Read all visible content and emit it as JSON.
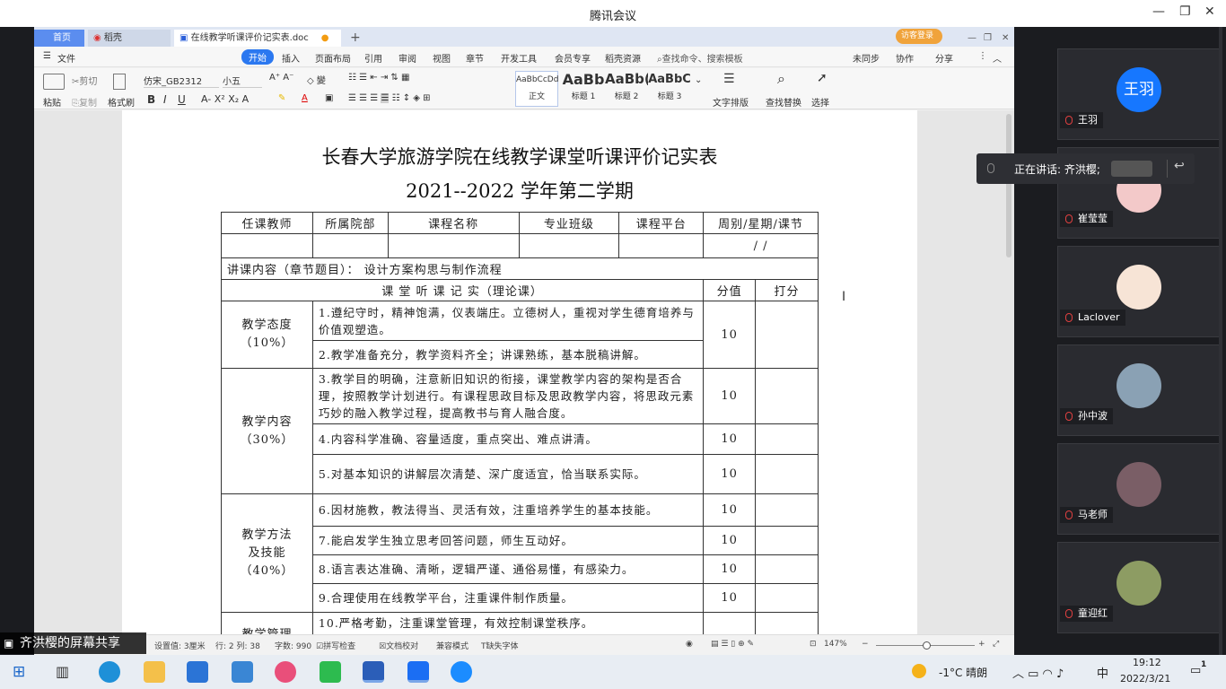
{
  "meeting": {
    "title": "腾讯会议"
  },
  "wps": {
    "tabs": [
      {
        "label": "首页"
      },
      {
        "label": "稻壳"
      },
      {
        "label": "在线教学听课评价记实表.doc"
      }
    ],
    "login_label": "访客登录",
    "ribbon_tabs": [
      "文件",
      "开始",
      "插入",
      "页面布局",
      "引用",
      "审阅",
      "视图",
      "章节",
      "开发工具",
      "会员专享",
      "稻壳资源"
    ],
    "search_placeholder": "查找命令、搜索模板",
    "actions": {
      "sync": "未同步",
      "collab": "协作",
      "share": "分享"
    },
    "toolbar": {
      "paste": "粘贴",
      "cut": "剪切",
      "copy": "复制",
      "format_painter": "格式刷",
      "font": "仿宋_GB2312",
      "size": "小五",
      "styles": [
        {
          "preview": "AaBbCcDd",
          "name": "正文"
        },
        {
          "preview": "AaBb",
          "name": "标题 1"
        },
        {
          "preview": "AaBb(",
          "name": "标题 2"
        },
        {
          "preview": "AaBbC",
          "name": "标题 3"
        }
      ],
      "text_layout": "文字排版",
      "find_replace": "查找替换",
      "select": "选择"
    },
    "status": {
      "setting": "设置值: 3厘米",
      "pos": "行: 2  列: 38",
      "words": "字数: 990",
      "spell": "拼写检查",
      "proof": "文档校对",
      "compat": "兼容模式",
      "missing_font": "缺失字体",
      "zoom": "147%"
    }
  },
  "document": {
    "title": "长春大学旅游学院在线教学课堂听课评价记实表",
    "subtitle": "2021--2022 学年第二学期",
    "header_cells": [
      "任课教师",
      "所属院部",
      "课程名称",
      "专业班级",
      "课程平台",
      "周别/星期/课节"
    ],
    "date_slot": "/   /",
    "topic": "讲课内容（章节题目）：  设计方案构思与制作流程",
    "record_header": "课 堂 听 课 记 实（理论课）",
    "score_header": "分值",
    "grade_header": "打分",
    "groups": {
      "attitude": "教学态度\n（10%）",
      "content": "教学内容\n（30%）",
      "method": "教学方法\n及技能\n（40%）",
      "manage": "教学管理"
    },
    "items": [
      "1.遵纪守时，精神饱满，仪表端庄。立德树人，重视对学生德育培养与价值观塑造。",
      "2.教学准备充分，教学资料齐全；讲课熟练，基本脱稿讲解。",
      "3.教学目的明确，注意新旧知识的衔接，课堂教学内容的架构是否合理，按照教学计划进行。有课程思政目标及思政教学内容，将思政元素巧妙的融入教学过程，提高教书与育人融合度。",
      "4.内容科学准确、容量适度，重点突出、难点讲清。",
      "5.对基本知识的讲解层次清楚、深广度适宜，恰当联系实际。",
      "6.因材施教，教法得当、灵活有效，注重培养学生的基本技能。",
      "7.能启发学生独立思考回答问题，师生互动好。",
      "8.语言表达准确、清晰，逻辑严谨、通俗易懂，有感染力。",
      "9.合理使用在线教学平台，注重课件制作质量。",
      "10.严格考勤，注重课堂管理，有效控制课堂秩序。"
    ],
    "scores": [
      "10",
      "10",
      "10",
      "10",
      "10",
      "10",
      "10",
      "10",
      "10"
    ]
  },
  "participants": [
    {
      "name": "王羽",
      "avatar_text": "王羽",
      "color": "#1677ff"
    },
    {
      "name": "崔莹莹",
      "color": "#f3c9c9"
    },
    {
      "name": "Laclover",
      "color": "#f7e4d6"
    },
    {
      "name": "孙中波",
      "color": "#8aa1b4"
    },
    {
      "name": "马老师",
      "color": "#7a5e66"
    },
    {
      "name": "童迎红",
      "color": "#8d9c63"
    }
  ],
  "speaking": "正在讲话: 齐洪樱;",
  "share_tag": "齐洪樱的屏幕共享",
  "taskbar": {
    "weather": "-1°C  晴朗",
    "ime": "中",
    "time": "19:12",
    "date": "2022/3/21",
    "notifications": "1"
  }
}
